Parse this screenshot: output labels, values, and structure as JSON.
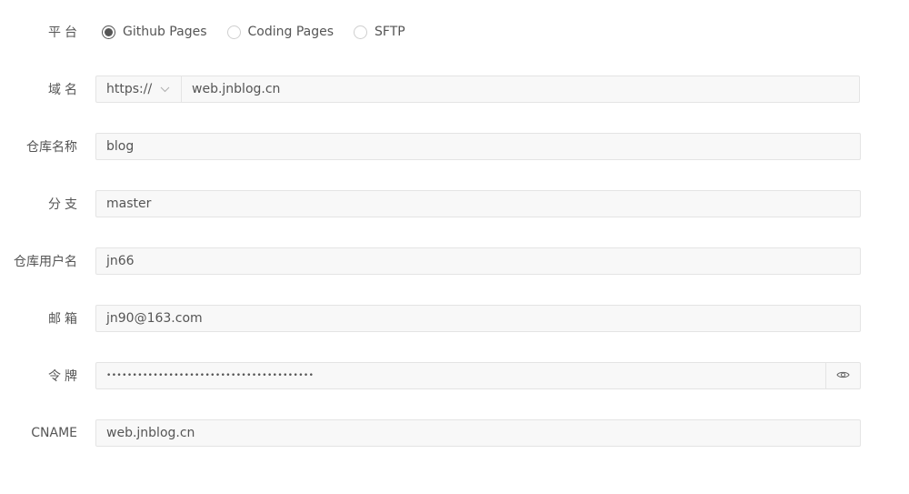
{
  "platform": {
    "label": "平台",
    "options": [
      {
        "label": "Github Pages",
        "checked": true
      },
      {
        "label": "Coding Pages",
        "checked": false
      },
      {
        "label": "SFTP",
        "checked": false
      }
    ]
  },
  "domain": {
    "label": "域名",
    "protocol": "https://",
    "value": "web.jnblog.cn"
  },
  "repo_name": {
    "label": "仓库名称",
    "value": "blog"
  },
  "branch": {
    "label": "分支",
    "value": "master"
  },
  "repo_user": {
    "label": "仓库用户名",
    "value": "jn66"
  },
  "email": {
    "label": "邮箱",
    "value": "jn90@163.com"
  },
  "token": {
    "label": "令牌",
    "masked_value": "••••••••••••••••••••••••••••••••••••••••"
  },
  "cname": {
    "label": "CNAME",
    "value": "web.jnblog.cn"
  },
  "icons": {
    "protocol_dropdown": "chevron-down-icon",
    "token_visibility": "eye-icon"
  }
}
